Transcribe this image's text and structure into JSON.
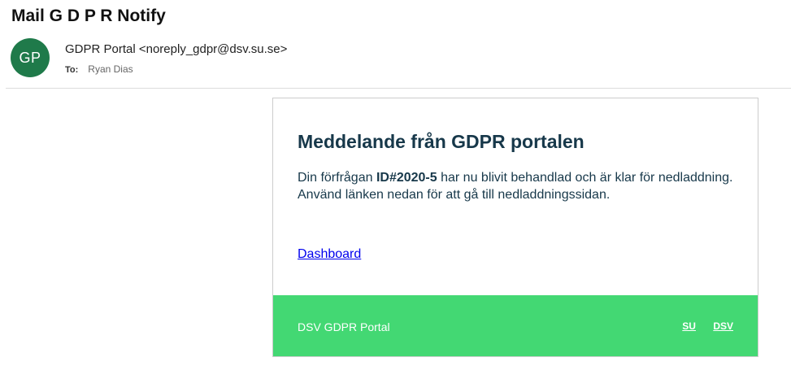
{
  "mail": {
    "subject": "Mail G D P R Notify",
    "avatar_initials": "GP",
    "avatar_color": "#1f7a4a",
    "sender": "GDPR Portal <noreply_gdpr@dsv.su.se>",
    "to_label": "To:",
    "to_name": "Ryan Dias"
  },
  "email": {
    "heading": "Meddelande från GDPR portalen",
    "body_prefix": "Din förfrågan ",
    "request_id": "ID#2020-5",
    "body_suffix": " har nu blivit behandlad och är klar för nedladdning.",
    "body_line2": "Använd länken nedan för att gå till nedladdningssidan.",
    "link_label": "Dashboard",
    "footer": {
      "brand": "DSV GDPR Portal",
      "links": [
        "SU",
        "DSV"
      ],
      "color": "#43d873"
    },
    "text_color": "#17384a"
  }
}
